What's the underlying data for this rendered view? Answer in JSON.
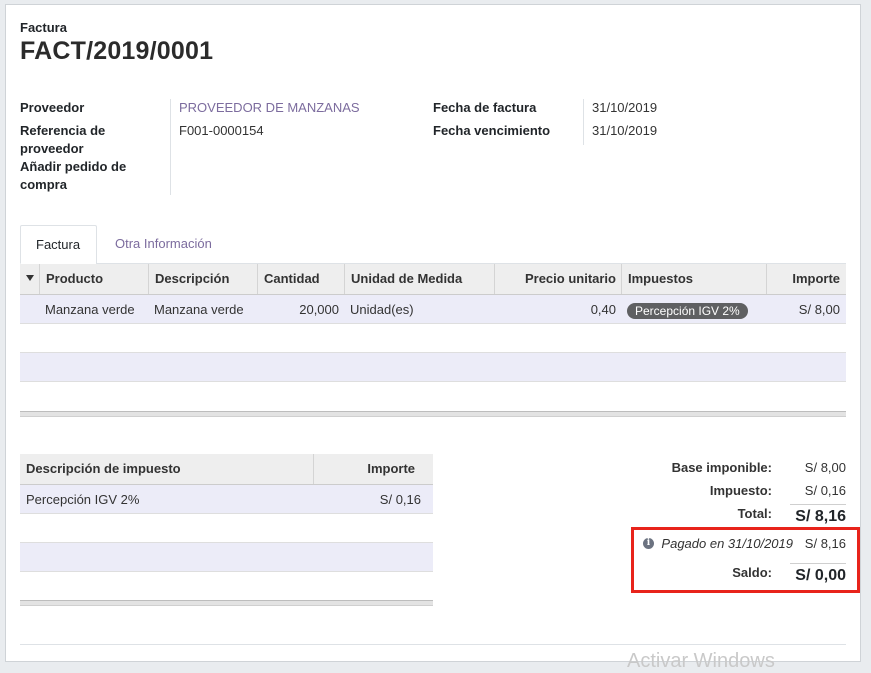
{
  "header": {
    "doc_type": "Factura",
    "doc_number": "FACT/2019/0001"
  },
  "details": {
    "supplier_label": "Proveedor",
    "supplier_value": "PROVEEDOR DE MANZANAS",
    "ref_label_1": "Referencia de",
    "ref_label_2": "proveedor",
    "ref_value": "F001-0000154",
    "po_label_1": "Añadir pedido de",
    "po_label_2": "compra",
    "invoice_date_label": "Fecha de factura",
    "invoice_date_value": "31/10/2019",
    "due_date_label": "Fecha vencimiento",
    "due_date_value": "31/10/2019"
  },
  "tabs": [
    {
      "label": "Factura",
      "active": true
    },
    {
      "label": "Otra Información",
      "active": false
    }
  ],
  "lines": {
    "columns": [
      "Producto",
      "Descripción",
      "Cantidad",
      "Unidad de Medida",
      "Precio unitario",
      "Impuestos",
      "Importe"
    ],
    "rows": [
      {
        "product": "Manzana verde",
        "description": "Manzana verde",
        "quantity": "20,000",
        "uom": "Unidad(es)",
        "unit_price": "0,40",
        "tax": "Percepción IGV 2%",
        "amount": "S/ 8,00"
      }
    ]
  },
  "taxes": {
    "columns": [
      "Descripción de impuesto",
      "Importe"
    ],
    "rows": [
      {
        "description": "Percepción IGV 2%",
        "amount": "S/ 0,16"
      }
    ]
  },
  "totals": {
    "base_label": "Base imponible:",
    "base_value": "S/ 8,00",
    "tax_label": "Impuesto:",
    "tax_value": "S/ 0,16",
    "total_label": "Total:",
    "total_value": "S/ 8,16",
    "payment_label": "Pagado en 31/10/2019",
    "payment_value": "S/ 8,16",
    "balance_label": "Saldo:",
    "balance_value": "S/ 0,00"
  },
  "watermark": "Activar Windows",
  "colors": {
    "link": "#7c6c9e",
    "row_tint": "#ececf8",
    "badge": "#5f6062",
    "highlight": "#e8231b"
  }
}
